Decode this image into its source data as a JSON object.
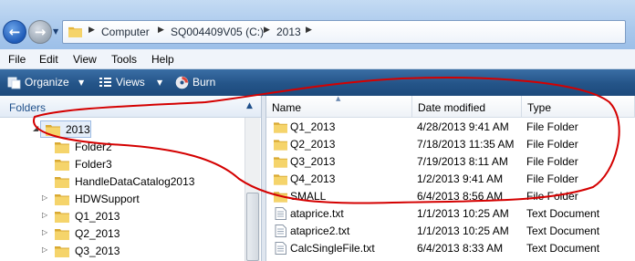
{
  "address_bar": {
    "back_icon": "back-arrow-icon",
    "forward_icon": "forward-arrow-icon",
    "breadcrumbs": [
      "Computer",
      "SQ004409V05 (C:)",
      "2013"
    ]
  },
  "menu": [
    "File",
    "Edit",
    "View",
    "Tools",
    "Help"
  ],
  "toolbar": {
    "organize": "Organize",
    "views": "Views",
    "burn": "Burn"
  },
  "folders_pane": {
    "title": "Folders",
    "tree": [
      {
        "label": "2013",
        "expander": "expanded",
        "selected": true
      },
      {
        "label": "Folder2"
      },
      {
        "label": "Folder3"
      },
      {
        "label": "HandleDataCatalog2013"
      },
      {
        "label": "HDWSupport",
        "expander": "collapsed"
      },
      {
        "label": "Q1_2013",
        "expander": "collapsed"
      },
      {
        "label": "Q2_2013",
        "expander": "collapsed"
      },
      {
        "label": "Q3_2013",
        "expander": "collapsed"
      }
    ]
  },
  "file_list": {
    "columns": [
      "Name",
      "Date modified",
      "Type"
    ],
    "sorted_by": "Name",
    "rows": [
      {
        "name": "Q1_2013",
        "date": "4/28/2013 9:41 AM",
        "type": "File Folder",
        "icon": "folder-icon"
      },
      {
        "name": "Q2_2013",
        "date": "7/18/2013 11:35 AM",
        "type": "File Folder",
        "icon": "folder-icon"
      },
      {
        "name": "Q3_2013",
        "date": "7/19/2013 8:11 AM",
        "type": "File Folder",
        "icon": "folder-icon"
      },
      {
        "name": "Q4_2013",
        "date": "1/2/2013 9:41 AM",
        "type": "File Folder",
        "icon": "folder-icon"
      },
      {
        "name": "SMALL",
        "date": "6/4/2013 8:56 AM",
        "type": "File Folder",
        "icon": "folder-icon"
      },
      {
        "name": "ataprice.txt",
        "date": "1/1/2013 10:25 AM",
        "type": "Text Document",
        "icon": "text-file-icon"
      },
      {
        "name": "ataprice2.txt",
        "date": "1/1/2013 10:25 AM",
        "type": "Text Document",
        "icon": "text-file-icon"
      },
      {
        "name": "CalcSingleFile.txt",
        "date": "6/4/2013 8:33 AM",
        "type": "Text Document",
        "icon": "text-file-icon"
      }
    ]
  },
  "colors": {
    "toolbar_bg": "#245488",
    "folder_yellow": "#f2c94c",
    "annotation_red": "#d40000",
    "selection": "#e5eef9"
  }
}
